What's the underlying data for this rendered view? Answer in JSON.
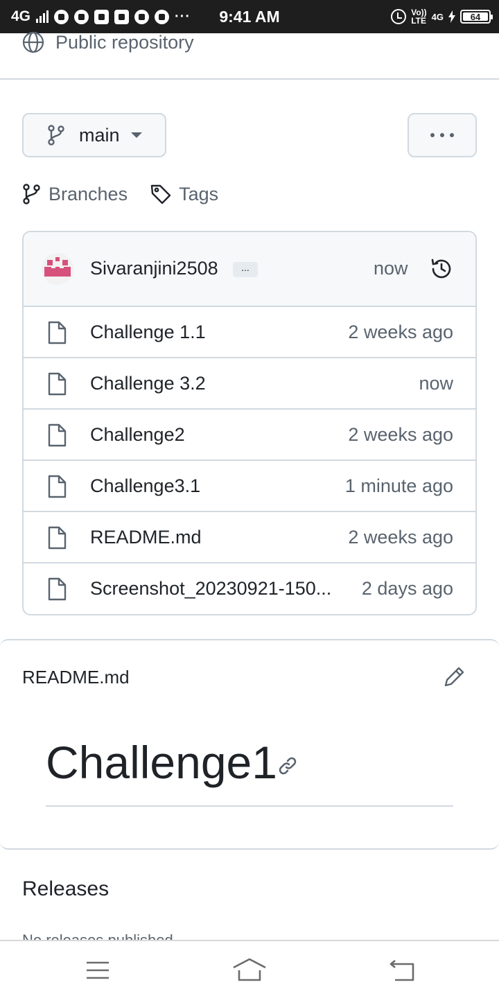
{
  "status_bar": {
    "network": "4G",
    "time": "9:41 AM",
    "volte_top": "Vo))",
    "volte_bottom": "LTE",
    "network_right": "4G",
    "battery": "64",
    "notification_icons": [
      "telegram-icon",
      "chrome-icon",
      "youtube-icon",
      "gallery-icon",
      "whatsapp-icon",
      "alarm-icon"
    ],
    "more": "···"
  },
  "repo": {
    "visibility": "Public repository",
    "branch": "main",
    "branches_label": "Branches",
    "tags_label": "Tags"
  },
  "commit": {
    "author": "Sivaranjini2508",
    "ellipsis": "...",
    "time": "now"
  },
  "files": [
    {
      "name": "Challenge 1.1",
      "time": "2 weeks ago"
    },
    {
      "name": "Challenge 3.2",
      "time": "now"
    },
    {
      "name": "Challenge2",
      "time": "2 weeks ago"
    },
    {
      "name": "Challenge3.1",
      "time": "1 minute ago"
    },
    {
      "name": "README.md",
      "time": "2 weeks ago"
    },
    {
      "name": "Screenshot_20230921-150...",
      "time": "2 days ago"
    }
  ],
  "readme": {
    "title": "README.md",
    "heading": "Challenge1"
  },
  "releases": {
    "title": "Releases",
    "subtitle": "No releases published"
  },
  "colors": {
    "accent_avatar": "#d6517c",
    "border": "#d1d9e0",
    "muted_text": "#59636e"
  }
}
